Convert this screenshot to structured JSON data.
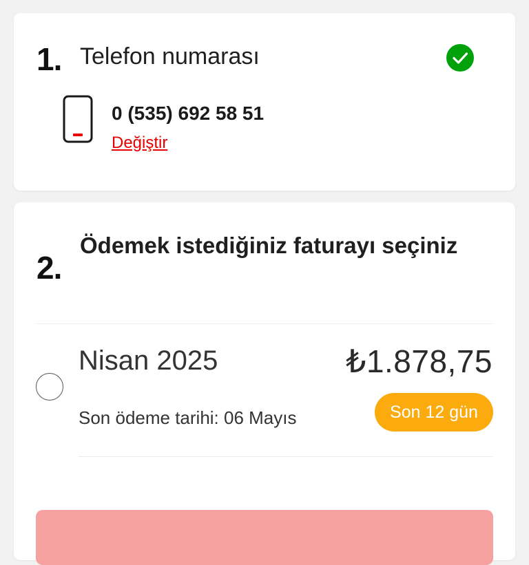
{
  "step1": {
    "number": "1.",
    "title": "Telefon numarası",
    "phone_number": "0 (535) 692 58 51",
    "change_label": "Değiştir",
    "status_icon": "check-circle-icon"
  },
  "step2": {
    "number": "2.",
    "title": "Ödemek istediğiniz faturayı seçiniz",
    "bill": {
      "period": "Nisan 2025",
      "amount": "₺1.878,75",
      "due_date": "Son ödeme tarihi: 06 Mayıs",
      "days_left": "Son 12 gün"
    }
  },
  "colors": {
    "accent_red": "#e60000",
    "success_green": "#00a10a",
    "badge_orange": "#fbab0e",
    "button_disabled": "#f4a19f"
  }
}
